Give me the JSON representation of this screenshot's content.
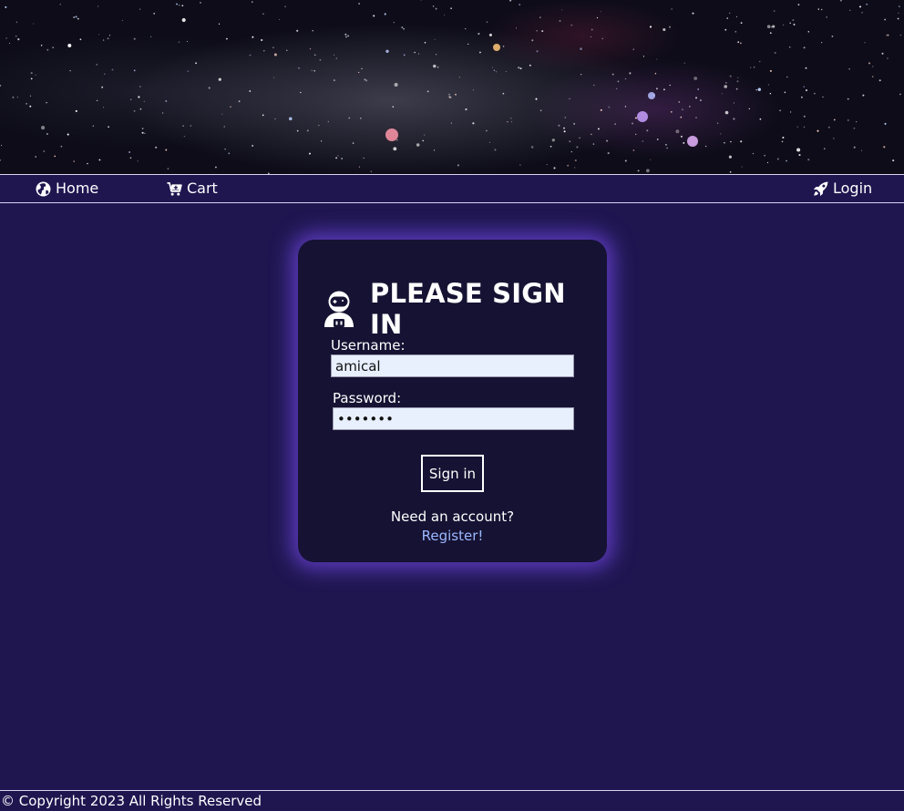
{
  "nav": {
    "home_label": "Home",
    "home_icon": "globe-icon",
    "cart_label": "Cart",
    "cart_icon": "cart-icon",
    "login_label": "Login",
    "login_icon": "rocket-icon"
  },
  "login_card": {
    "title": "PLEASE SIGN IN",
    "title_icon": "astronaut-icon",
    "username_label": "Username:",
    "username_value": "amical",
    "password_label": "Password:",
    "password_value": "•••••••",
    "signin_label": "Sign in",
    "need_account_text": "Need an account?",
    "register_label": "Register!"
  },
  "footer": {
    "copyright": "© Copyright 2023 All Rights Reserved"
  },
  "colors": {
    "page_background": "#1f1650",
    "card_background": "#161233",
    "card_glow": "#6e46dc",
    "input_background": "#e8f0fe",
    "link_color": "#9bb8ff"
  }
}
